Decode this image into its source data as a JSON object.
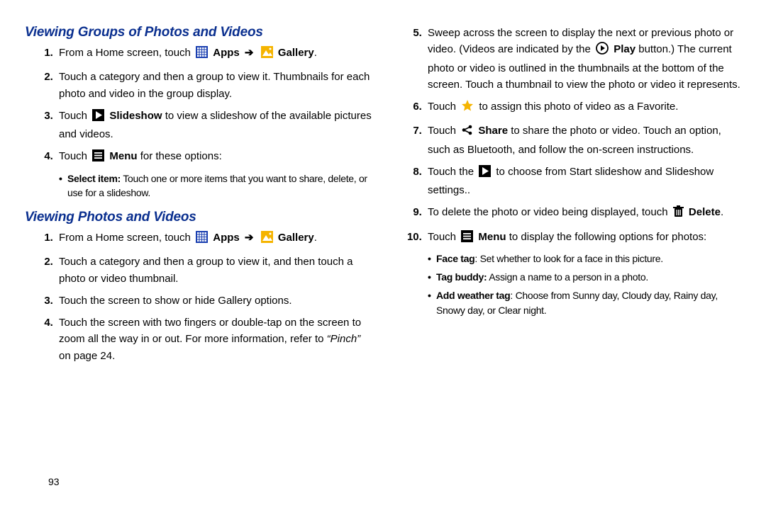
{
  "pageNumber": "93",
  "section1": {
    "title": "Viewing Groups of Photos and Videos",
    "s1": {
      "a": "From a Home screen, touch ",
      "apps": "Apps",
      "gallery": "Gallery",
      "end": "."
    },
    "s2": "Touch a category and then a group to view it. Thumbnails for each photo and video in the group display.",
    "s3": {
      "a": "Touch ",
      "b": "Slideshow",
      "c": " to view a slideshow of the available pictures and videos."
    },
    "s4": {
      "a": "Touch ",
      "b": "Menu",
      "c": " for these options:"
    },
    "s4_sub1": {
      "b": "Select item:",
      "t": " Touch one or more items that you want to share, delete, or use for a slideshow."
    }
  },
  "section2": {
    "title": "Viewing Photos and Videos",
    "s1": {
      "a": "From a Home screen, touch ",
      "apps": "Apps",
      "gallery": "Gallery",
      "end": "."
    },
    "s2": "Touch a category and then a group to view it, and then touch a photo or video thumbnail.",
    "s3": "Touch the screen to show or hide Gallery options.",
    "s4": {
      "a": "Touch the screen with two fingers or double-tap on the screen to zoom all the way in or out. For more information, refer to ",
      "ref": "“Pinch”",
      "c": " on page 24."
    }
  },
  "right": {
    "s5": {
      "a": "Sweep across the screen to display the next or previous photo or video. (Videos are indicated by the ",
      "play": "Play",
      "b": " button.) The current photo or video is outlined in the thumbnails at the bottom of the screen. Touch a thumbnail to view the photo or video it represents."
    },
    "s6": {
      "a": "Touch ",
      "b": " to assign this photo of video as a Favorite."
    },
    "s7": {
      "a": "Touch ",
      "share": "Share",
      "b": " to share the photo or video. Touch an option, such as Bluetooth, and follow the on-screen instructions."
    },
    "s8": {
      "a": "Touch the ",
      "b": " to choose from Start slideshow and Slideshow settings.."
    },
    "s9": {
      "a": "To delete the photo or video being displayed, touch ",
      "del": "Delete",
      "end": "."
    },
    "s10": {
      "a": "Touch ",
      "menu": "Menu",
      "b": " to display the following options for photos:"
    },
    "sub1": {
      "b": "Face tag",
      "t": ": Set whether to look for a face in this picture."
    },
    "sub2": {
      "b": "Tag buddy:",
      "t": " Assign a name to a person in a photo."
    },
    "sub3": {
      "b": "Add weather tag",
      "t": ": Choose from Sunny day, Cloudy day, Rainy day, Snowy day, or Clear night."
    }
  }
}
